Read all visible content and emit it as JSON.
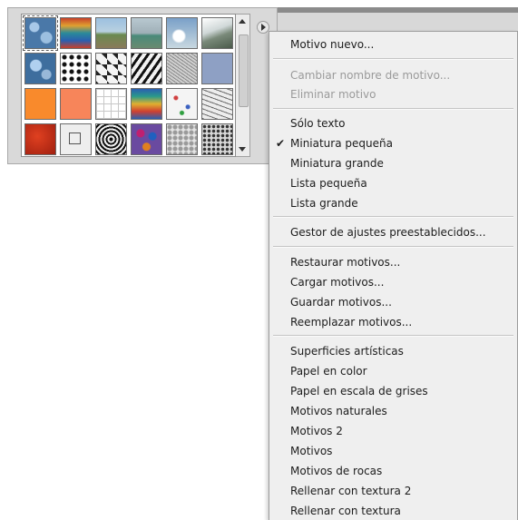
{
  "colors": {
    "panel_bg": "#d9d9d9",
    "menu_bg": "#efefef",
    "menu_text": "#1c1c1c",
    "menu_disabled_text": "#9a9a9a"
  },
  "pattern_grid": {
    "rows": 4,
    "columns": 6,
    "selected_index": 0,
    "tiles": [
      "blue-bubbles",
      "rainbow-satin",
      "landscape",
      "fields",
      "clouds-sky",
      "mountains",
      "blue-bubbles",
      "black-dots",
      "zigzag",
      "zebra",
      "gray-grain",
      "slate-blue",
      "orange",
      "salmon",
      "white-grid",
      "rainbow-satin-2",
      "confetti",
      "sketch",
      "red-texture",
      "square-frame",
      "checkers",
      "mosaic",
      "pebbles",
      "rock-speckle"
    ]
  },
  "menu": {
    "check_icon": "checkmark-icon",
    "checked_item": "small_thumbnail",
    "items": {
      "new_pattern": "Motivo nuevo...",
      "rename_pattern": "Cambiar nombre de motivo...",
      "delete_pattern": "Eliminar motivo",
      "text_only": "Sólo texto",
      "small_thumbnail": "Miniatura pequeña",
      "large_thumbnail": "Miniatura grande",
      "small_list": "Lista pequeña",
      "large_list": "Lista grande",
      "preset_manager": "Gestor de ajustes preestablecidos...",
      "reset_patterns": "Restaurar motivos...",
      "load_patterns": "Cargar motivos...",
      "save_patterns": "Guardar motivos...",
      "replace_patterns": "Reemplazar motivos...",
      "artistic_surfaces": "Superficies artísticas",
      "color_paper": "Papel en color",
      "grayscale_paper": "Papel en escala de grises",
      "nature_patterns": "Motivos naturales",
      "patterns_2": "Motivos 2",
      "patterns": "Motivos",
      "rock_patterns": "Motivos de rocas",
      "texture_fill_2": "Rellenar con textura 2",
      "texture_fill": "Rellenar con textura"
    }
  }
}
